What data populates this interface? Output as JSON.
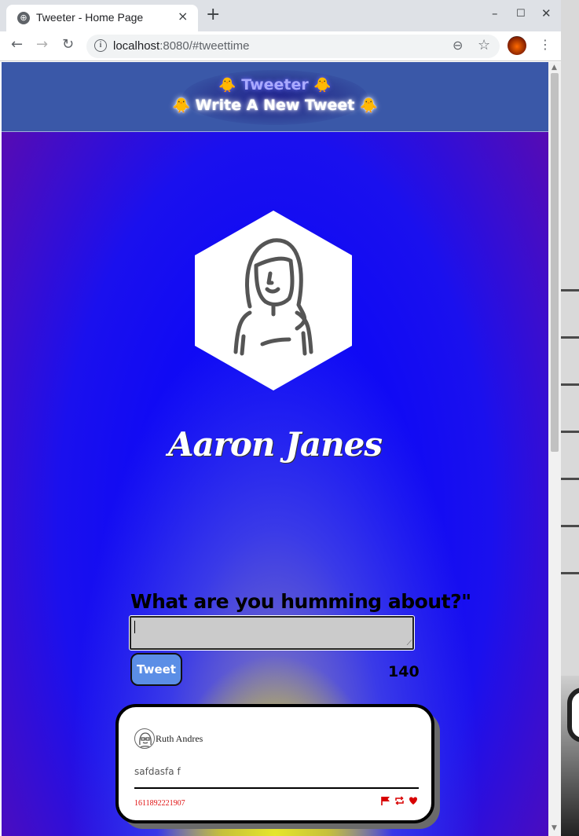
{
  "browser": {
    "tab_title": "Tweeter - Home Page",
    "tab_close": "×",
    "new_tab": "+",
    "url_host": "localhost",
    "url_rest": ":8080/#tweettime",
    "win_min": "–",
    "win_max": "☐",
    "win_close": "✕"
  },
  "header": {
    "line1": "Tweeter",
    "line2": "Write A New Tweet",
    "chick_icon": "🐥"
  },
  "profile": {
    "name": "Aaron Janes"
  },
  "compose": {
    "prompt": "What are you humming about?\"",
    "text": "",
    "button_label": "Tweet",
    "counter": "140"
  },
  "tweets": [
    {
      "author": "Ruth Andres",
      "content": "safdasfa f",
      "timestamp": "1611892221907",
      "icons": [
        "flag-icon",
        "retweet-icon",
        "heart-icon"
      ]
    }
  ],
  "colors": {
    "header_bg": "#3a58a8",
    "tweet_button": "#5b8ee6",
    "action_red": "#d80000"
  }
}
